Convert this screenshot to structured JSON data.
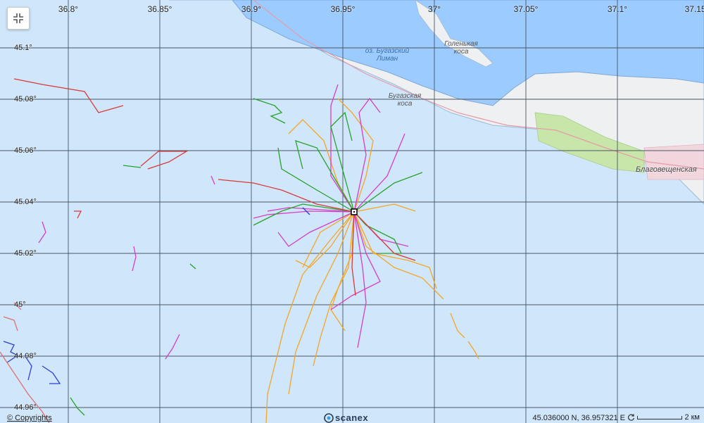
{
  "map": {
    "longitude_labels": [
      "36.8°",
      "36.85°",
      "36.9°",
      "36.95°",
      "37°",
      "37.05°",
      "37.1°",
      "37.15°"
    ],
    "latitude_labels": [
      "45.1°",
      "45.08°",
      "45.06°",
      "45.04°",
      "45.02°",
      "45°",
      "44.98°",
      "44.96°"
    ],
    "places": {
      "liman_line1": "оз. Бугазский",
      "liman_line2": "Лиман",
      "spit1_line1": "Голенькая",
      "spit1_line2": "коса",
      "spit2_line1": "Бугазская",
      "spit2_line2": "коса",
      "town": "Благовещенская"
    },
    "colors": {
      "sea": "#cfe6fb",
      "land": "#eef0f2",
      "lagoon": "#9ccbff",
      "green": "#c8e6a9",
      "grid": "#4a5563",
      "track_orange": "#f5a623",
      "track_magenta": "#d63fc4",
      "track_green": "#27a22b",
      "track_red": "#d93a3a",
      "track_blue": "#2f3fd6"
    },
    "center_marker": "target-marker"
  },
  "controls": {
    "collapse_icon": "collapse-icon"
  },
  "footer": {
    "copyright": "© Copyrights",
    "logo": "scanex",
    "coords": "45.036000 N, 36.957321 E",
    "scale": "2 км"
  }
}
